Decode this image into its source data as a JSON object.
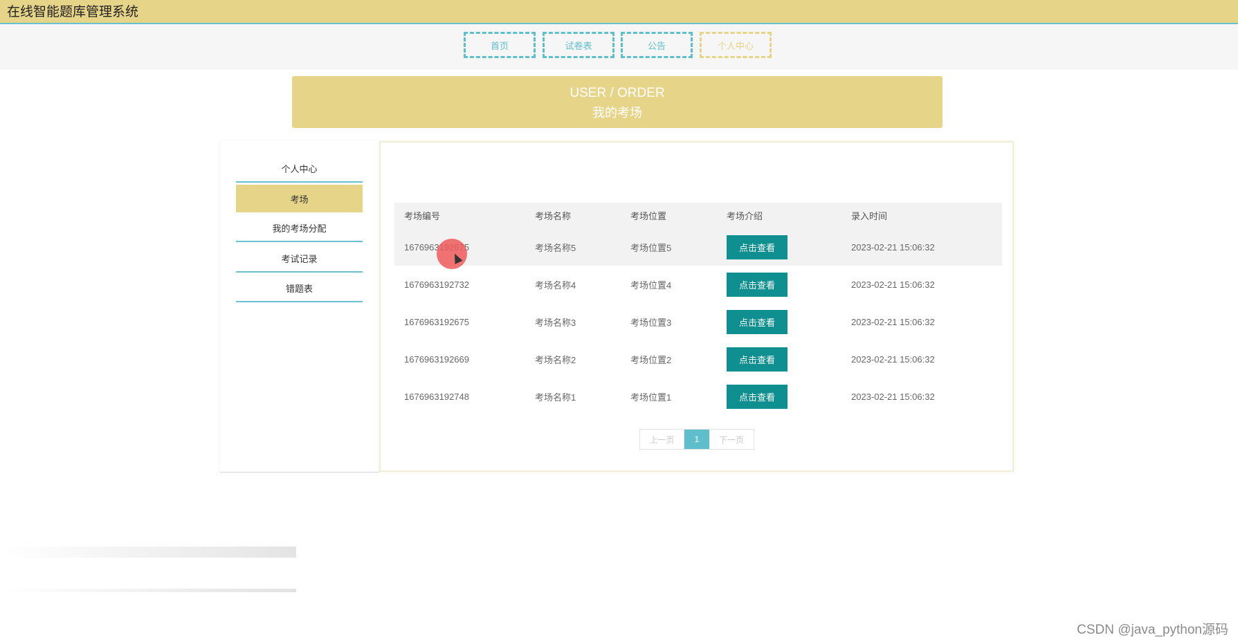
{
  "app": {
    "title": "在线智能题库管理系统"
  },
  "nav": {
    "items": [
      {
        "label": "首页",
        "active": false
      },
      {
        "label": "试卷表",
        "active": false
      },
      {
        "label": "公告",
        "active": false
      },
      {
        "label": "个人中心",
        "active": true
      }
    ]
  },
  "banner": {
    "en": "USER / ORDER",
    "cn": "我的考场"
  },
  "sidebar": {
    "items": [
      {
        "label": "个人中心",
        "active": false
      },
      {
        "label": "考场",
        "active": true
      },
      {
        "label": "我的考场分配",
        "active": false
      },
      {
        "label": "考试记录",
        "active": false
      },
      {
        "label": "错题表",
        "active": false
      }
    ]
  },
  "table": {
    "headers": [
      "考场编号",
      "考场名称",
      "考场位置",
      "考场介绍",
      "录入时间"
    ],
    "rows": [
      {
        "id": "1676963192675",
        "name": "考场名称5",
        "location": "考场位置5",
        "action": "点击查看",
        "time": "2023-02-21 15:06:32"
      },
      {
        "id": "1676963192732",
        "name": "考场名称4",
        "location": "考场位置4",
        "action": "点击查看",
        "time": "2023-02-21 15:06:32"
      },
      {
        "id": "1676963192675",
        "name": "考场名称3",
        "location": "考场位置3",
        "action": "点击查看",
        "time": "2023-02-21 15:06:32"
      },
      {
        "id": "1676963192669",
        "name": "考场名称2",
        "location": "考场位置2",
        "action": "点击查看",
        "time": "2023-02-21 15:06:32"
      },
      {
        "id": "1676963192748",
        "name": "考场名称1",
        "location": "考场位置1",
        "action": "点击查看",
        "time": "2023-02-21 15:06:32"
      }
    ]
  },
  "pagination": {
    "prev": "上一页",
    "current": "1",
    "next": "下一页"
  },
  "watermark": "CSDN @java_python源码",
  "colors": {
    "accent_gold": "#e6d488",
    "accent_teal": "#5ebecc",
    "button_teal": "#0f8f8f"
  }
}
